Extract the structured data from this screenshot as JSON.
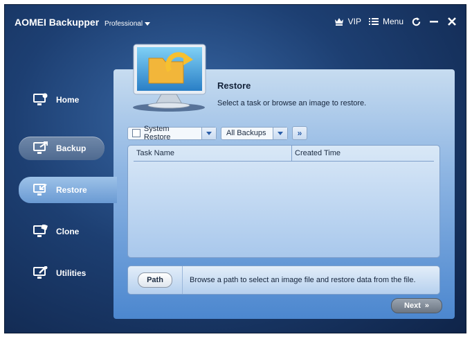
{
  "app": {
    "name": "AOMEI Backupper",
    "edition": "Professional"
  },
  "titlebar": {
    "vip": "VIP",
    "menu": "Menu"
  },
  "sidebar": {
    "items": [
      {
        "label": "Home",
        "icon": "home-icon"
      },
      {
        "label": "Backup",
        "icon": "backup-icon"
      },
      {
        "label": "Restore",
        "icon": "restore-icon",
        "active": true
      },
      {
        "label": "Clone",
        "icon": "clone-icon"
      },
      {
        "label": "Utilities",
        "icon": "utilities-icon"
      }
    ]
  },
  "restore": {
    "title": "Restore",
    "description": "Select a task or browse an image to restore.",
    "filter_system": "System Restore",
    "filter_backups": "All Backups",
    "columns": [
      "Task Name",
      "Created Time"
    ],
    "path_button": "Path",
    "path_description": "Browse a path to select an image file and restore data from the file.",
    "next_button": "Next"
  }
}
